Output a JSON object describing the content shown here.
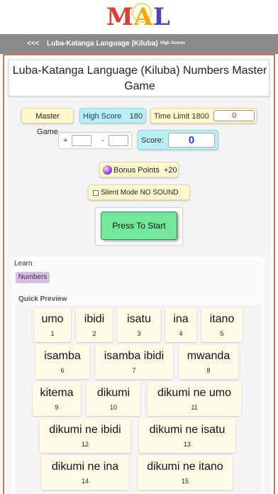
{
  "logo": {
    "m": "M",
    "a": "A",
    "l": "L"
  },
  "nav": {
    "back": "<<<",
    "title": "Luba-Katanga Language (Kiluba)",
    "high_scores": "High Scores"
  },
  "page_title": "Luba-Katanga Language (Kiluba) Numbers Master Game",
  "game": {
    "master_game": "Master Game",
    "high_score_label": "High Score",
    "high_score_value": "180",
    "time_limit_label": "Time Limit 1800",
    "time_value": "0",
    "plus": "+",
    "minus": "-",
    "score_label": "Score:",
    "score_value": "0",
    "bonus_label": "Bonus Points",
    "bonus_value": "+20",
    "silent_label": "Silent Mode NO SOUND",
    "start_label": "Press To Start"
  },
  "learn": {
    "label": "Learn",
    "numbers_button": "Numbers",
    "quick_preview": "Quick Preview"
  },
  "cards": [
    {
      "word": "umo",
      "num": "1"
    },
    {
      "word": "ibidi",
      "num": "2"
    },
    {
      "word": "isatu",
      "num": "3"
    },
    {
      "word": "ina",
      "num": "4"
    },
    {
      "word": "itano",
      "num": "5"
    },
    {
      "word": "isamba",
      "num": "6"
    },
    {
      "word": "isamba ibidi",
      "num": "7"
    },
    {
      "word": "mwanda",
      "num": "8"
    },
    {
      "word": "kitema",
      "num": "9"
    },
    {
      "word": "dikumi",
      "num": "10"
    },
    {
      "word": "dikumi ne umo",
      "num": "11"
    },
    {
      "word": "dikumi ne ibidi",
      "num": "12"
    },
    {
      "word": "dikumi ne isatu",
      "num": "13"
    },
    {
      "word": "dikumi ne ina",
      "num": "14"
    },
    {
      "word": "dikumi ne itano",
      "num": "15"
    }
  ],
  "colors": {
    "accent_frame": "#c97a4a",
    "yellow_pill": "#fff8cf",
    "cyan_pill": "#b9f0f6",
    "start_green": "#72e79a",
    "numbers_purple": "#d8bde8"
  }
}
